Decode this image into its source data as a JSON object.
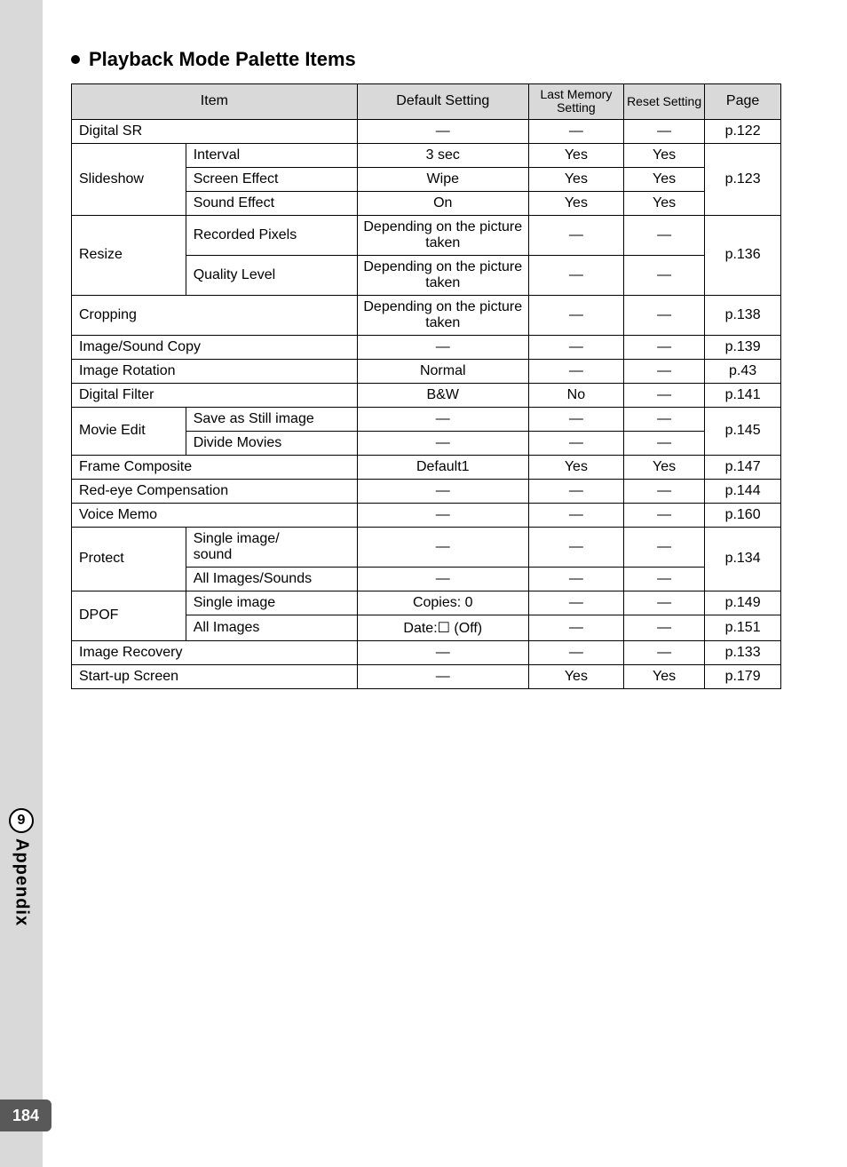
{
  "side": {
    "chapter_number": "9",
    "chapter_label": "Appendix",
    "page_number": "184"
  },
  "section_title": "Playback Mode Palette Items",
  "headers": {
    "item": "Item",
    "default": "Default Setting",
    "last": "Last Memory Setting",
    "reset": "Reset Setting",
    "page": "Page"
  },
  "rows": {
    "digital_sr": {
      "item": "Digital SR",
      "default": "—",
      "last": "—",
      "reset": "—",
      "page": "p.122"
    },
    "slideshow_label": "Slideshow",
    "slideshow_interval": {
      "sub": "Interval",
      "default": "3 sec",
      "last": "Yes",
      "reset": "Yes"
    },
    "slideshow_screen": {
      "sub": "Screen Effect",
      "default": "Wipe",
      "last": "Yes",
      "reset": "Yes"
    },
    "slideshow_sound": {
      "sub": "Sound Effect",
      "default": "On",
      "last": "Yes",
      "reset": "Yes"
    },
    "slideshow_page": "p.123",
    "resize_label": "Resize",
    "resize_recorded": {
      "sub": "Recorded Pixels",
      "default": "Depending on the picture taken",
      "last": "—",
      "reset": "—"
    },
    "resize_quality": {
      "sub": "Quality Level",
      "default": "Depending on the picture taken",
      "last": "—",
      "reset": "—"
    },
    "resize_page": "p.136",
    "cropping": {
      "item": "Cropping",
      "default": "Depending on the picture taken",
      "last": "—",
      "reset": "—",
      "page": "p.138"
    },
    "image_sound_copy": {
      "item": "Image/Sound Copy",
      "default": "—",
      "last": "—",
      "reset": "—",
      "page": "p.139"
    },
    "image_rotation": {
      "item": "Image Rotation",
      "default": "Normal",
      "last": "—",
      "reset": "—",
      "page": "p.43"
    },
    "digital_filter": {
      "item": "Digital Filter",
      "default": "B&W",
      "last": "No",
      "reset": "—",
      "page": "p.141"
    },
    "movie_edit_label": "Movie Edit",
    "movie_save": {
      "sub": "Save as Still image",
      "default": "—",
      "last": "—",
      "reset": "—"
    },
    "movie_divide": {
      "sub": "Divide Movies",
      "default": "—",
      "last": "—",
      "reset": "—"
    },
    "movie_page": "p.145",
    "frame_composite": {
      "item": "Frame Composite",
      "default": "Default1",
      "last": "Yes",
      "reset": "Yes",
      "page": "p.147"
    },
    "red_eye": {
      "item": "Red-eye Compensation",
      "default": "—",
      "last": "—",
      "reset": "—",
      "page": "p.144"
    },
    "voice_memo": {
      "item": "Voice Memo",
      "default": "—",
      "last": "—",
      "reset": "—",
      "page": "p.160"
    },
    "protect_label": "Protect",
    "protect_single": {
      "sub": "Single image/\nsound",
      "default": "—",
      "last": "—",
      "reset": "—"
    },
    "protect_all": {
      "sub": "All Images/Sounds",
      "default": "—",
      "last": "—",
      "reset": "—"
    },
    "protect_page": "p.134",
    "dpof_label": "DPOF",
    "dpof_single": {
      "sub": "Single image",
      "default": "Copies: 0",
      "last": "—",
      "reset": "—",
      "page": "p.149"
    },
    "dpof_all": {
      "sub": "All Images",
      "default": "Date:☐ (Off)",
      "last": "—",
      "reset": "—",
      "page": "p.151"
    },
    "image_recovery": {
      "item": "Image Recovery",
      "default": "—",
      "last": "—",
      "reset": "—",
      "page": "p.133"
    },
    "startup_screen": {
      "item": "Start-up Screen",
      "default": "—",
      "last": "Yes",
      "reset": "Yes",
      "page": "p.179"
    }
  }
}
